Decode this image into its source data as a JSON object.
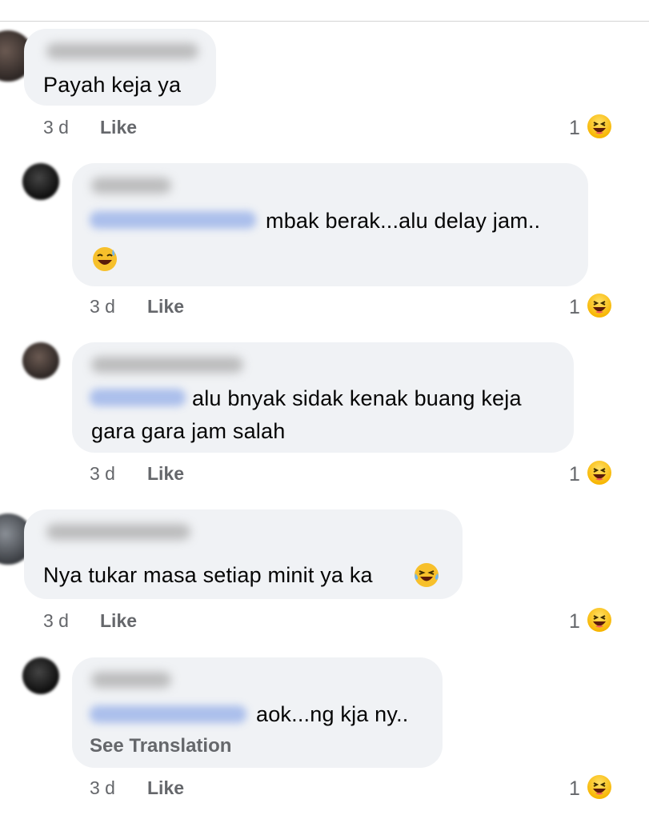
{
  "comments": [
    {
      "text": "Payah keja ya",
      "time": "3 d",
      "like": "Like",
      "reactions": "1"
    },
    {
      "text": "mbak berak...alu delay jam..",
      "time": "3 d",
      "like": "Like",
      "reactions": "1",
      "trailing_emoji": "sweat-smile"
    },
    {
      "text_line1": "alu bnyak sidak kenak buang keja",
      "text_line2": "gara gara jam salah",
      "time": "3 d",
      "like": "Like",
      "reactions": "1"
    },
    {
      "text": "Nya tukar masa setiap minit ya ka",
      "time": "3 d",
      "like": "Like",
      "reactions": "1",
      "trailing_emoji": "joy"
    },
    {
      "text": "aok...ng kja ny..",
      "see_translation": "See Translation",
      "time": "3 d",
      "like": "Like",
      "reactions": "1"
    }
  ],
  "reaction_icon": "haha-emoji",
  "colors": {
    "bubble": "#f0f2f5",
    "meta": "#65676b",
    "mention": "#385898"
  }
}
